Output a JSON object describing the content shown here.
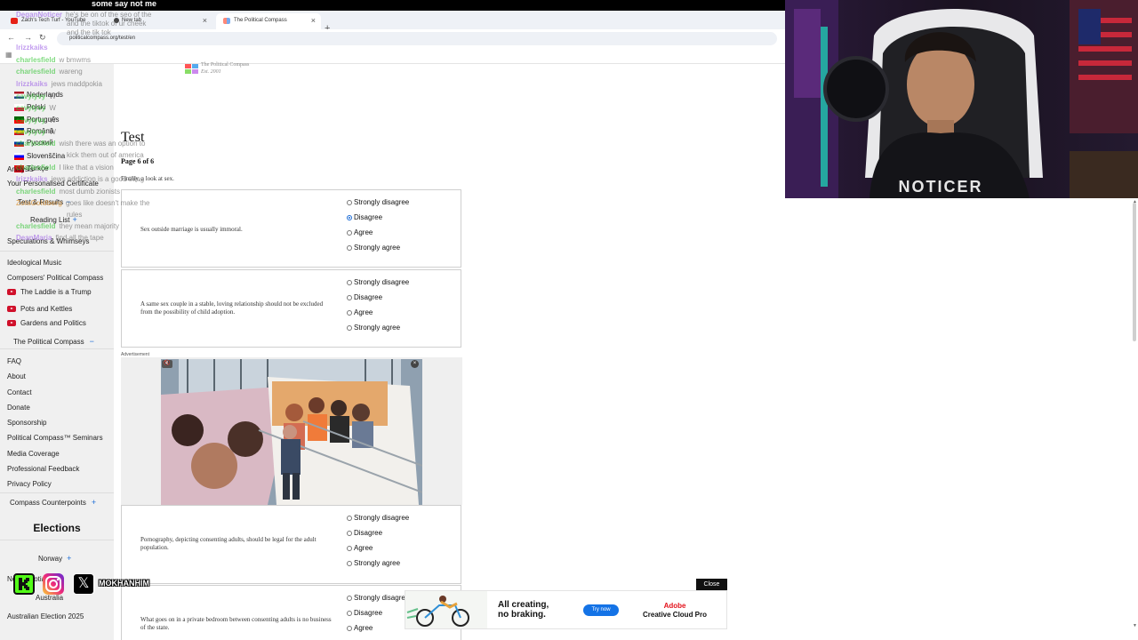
{
  "stream": {
    "top_caption": "some say not me",
    "social_handle": "MOKHANHIM",
    "shirt_text": "NOTICER"
  },
  "browser": {
    "tabs": [
      {
        "label": "Zach's Tech Turf - YouTube"
      },
      {
        "label": "New tab"
      },
      {
        "label": "The Political Compass"
      }
    ],
    "url": "politicalcompass.org/test/en",
    "new_tab_symbol": "+",
    "close_symbol": "×"
  },
  "sidebar": {
    "languages": [
      {
        "label": "Nederlands",
        "flag_colors": [
          "#ae1c28",
          "#ffffff",
          "#21468b"
        ]
      },
      {
        "label": "Polski",
        "flag_colors": [
          "#ffffff",
          "#dc143c"
        ]
      },
      {
        "label": "Português",
        "flag_colors": [
          "#006600",
          "#ff0000"
        ]
      },
      {
        "label": "Română",
        "flag_colors": [
          "#002b7f",
          "#fcd116",
          "#ce1126"
        ]
      },
      {
        "label": "Русский",
        "flag_colors": [
          "#ffffff",
          "#0039a6",
          "#d52b1e"
        ]
      },
      {
        "label": "Slovenščina",
        "flag_colors": [
          "#ffffff",
          "#0000ff",
          "#ff0000"
        ]
      },
      {
        "label": "Türkçe",
        "flag_colors": [
          "#e30a17"
        ]
      }
    ],
    "links_top": [
      "Analysis",
      "Your Personalised Certificate",
      "Test & Results",
      "Reading List"
    ],
    "speculations": "Speculations & Whimseys",
    "media_links": [
      {
        "label": "Ideological Music",
        "icon": false
      },
      {
        "label": "Composers' Political Compass",
        "icon": false
      },
      {
        "label": "The Laddie is a Trump",
        "icon": true
      },
      {
        "label": "Pots and Kettles",
        "icon": true
      },
      {
        "label": "Gardens and Politics",
        "icon": true
      }
    ],
    "political_compass": "The Political Compass",
    "minus_symbol": "−",
    "plus_symbol": "+",
    "info_links": [
      "FAQ",
      "About",
      "Contact",
      "Donate",
      "Sponsorship",
      "Political Compass™ Seminars",
      "Media Coverage",
      "Professional Feedback",
      "Privacy Policy"
    ],
    "compass_counterpoints": "Compass Counterpoints",
    "elections_heading": "Elections",
    "elections": [
      "Norway",
      "Nova Scotia",
      "Australia",
      "Australian Election 2025"
    ]
  },
  "chat": [
    {
      "user": "DeganNoticer",
      "msg": "he's be on of the seo of the",
      "color": "p"
    },
    {
      "user": "",
      "msg": "and the tiktok of ur cheek",
      "color": "g"
    },
    {
      "user": "",
      "msg": "and the tik tok",
      "color": "g"
    },
    {
      "user": "lrizzkaiks",
      "msg": "",
      "color": "p"
    },
    {
      "user": "charlesfield",
      "msg": "w bmwms",
      "color": "g"
    },
    {
      "user": "charlesfield",
      "msg": "wareng",
      "color": "g"
    },
    {
      "user": "lrizzkaiks",
      "msg": "jews maddpokia",
      "color": "p"
    },
    {
      "user": "cavylyvy",
      "msg": "W",
      "color": "g"
    },
    {
      "user": "cavylyvy",
      "msg": "W",
      "color": "g"
    },
    {
      "user": "cavylyvy",
      "msg": "W",
      "color": "g"
    },
    {
      "user": "cavylyvy",
      "msg": "W",
      "color": "g"
    },
    {
      "user": "charlesfield",
      "msg": "wish there was an option to",
      "color": "g"
    },
    {
      "user": "",
      "msg": "kick them out of america",
      "color": "g"
    },
    {
      "user": "charlesfield",
      "msg": "I like that a vision",
      "color": "g"
    },
    {
      "user": "lrizzkaiks",
      "msg": "jews addiction is a good thing",
      "color": "p"
    },
    {
      "user": "charlesfield",
      "msg": "most dumb zionists",
      "color": "g"
    },
    {
      "user": "ZolaGoldberg",
      "msg": "goes like doesn't make the",
      "color": "k"
    },
    {
      "user": "",
      "msg": "rules",
      "color": "g"
    },
    {
      "user": "charlesfield",
      "msg": "they mean majority",
      "color": "g"
    },
    {
      "user": "DeanMaria",
      "msg": "find all the tape",
      "color": "p"
    }
  ],
  "content": {
    "logo_text": "The Political Compass",
    "logo_sub": "Est. 2001",
    "title": "Test",
    "page_indicator": "Page 6 of 6",
    "intro": "Finally, a look at sex.",
    "options": [
      "Strongly disagree",
      "Disagree",
      "Agree",
      "Strongly agree"
    ],
    "questions": [
      {
        "text": "Sex outside marriage is usually immoral.",
        "selected": 1
      },
      {
        "text": "A same sex couple in a stable, loving relationship should not be excluded from the possibility of child adoption.",
        "selected": -1
      },
      {
        "text": "Pornography, depicting consenting adults, should be legal for the adult population.",
        "selected": -1
      },
      {
        "text": "What goes on in a private bedroom between consenting adults is no business of the state.",
        "selected": -1
      }
    ],
    "ad_label": "Advertisement",
    "ad_mute_icon": "mute-icon",
    "ad_close_symbol": "×"
  },
  "banner": {
    "headline_1": "All creating,",
    "headline_2": "no braking.",
    "cta": "Try now",
    "brand_1": "Adobe",
    "brand_2": "Creative Cloud Pro",
    "close": "Close"
  },
  "colors": {
    "accent": "#1a6bd6",
    "kick_green": "#53fc18",
    "adobe_red": "#e3121b"
  }
}
